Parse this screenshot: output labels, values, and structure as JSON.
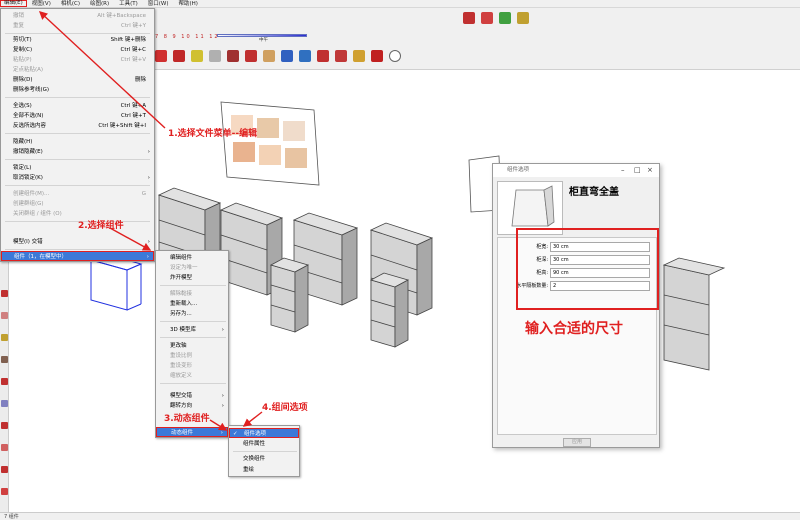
{
  "menubar": {
    "items": [
      "编辑(E)",
      "视图(V)",
      "相机(C)",
      "绘图(R)",
      "工具(T)",
      "窗口(W)",
      "帮助(H)"
    ]
  },
  "toolbar": {
    "ruler_text": "7 8 9 10 11 12",
    "scale_label": "中午"
  },
  "edit_menu": {
    "items": [
      {
        "label": "撤销",
        "shortcut": "Alt 键+Backspace",
        "disabled": true
      },
      {
        "label": "重复",
        "shortcut": "Ctrl 键+Y",
        "disabled": true
      },
      {
        "label": "剪切(T)",
        "shortcut": "Shift 键+删除"
      },
      {
        "label": "复制(C)",
        "shortcut": "Ctrl 键+C"
      },
      {
        "label": "粘贴(P)",
        "shortcut": "Ctrl 键+V",
        "disabled": true
      },
      {
        "label": "定点粘贴(A)",
        "shortcut": "",
        "disabled": true
      },
      {
        "label": "删除(D)",
        "shortcut": "删除"
      },
      {
        "label": "删除参考线(G)",
        "shortcut": ""
      },
      {
        "label": "全选(S)",
        "shortcut": "Ctrl 键+A"
      },
      {
        "label": "全部不选(N)",
        "shortcut": "Ctrl 键+T"
      },
      {
        "label": "反选所选内容",
        "shortcut": "Ctrl 键+Shift 键+I"
      },
      {
        "label": "隐藏(H)",
        "shortcut": ""
      },
      {
        "label": "撤销隐藏(E)",
        "shortcut": "",
        "submenu": true
      },
      {
        "label": "锁定(L)",
        "shortcut": ""
      },
      {
        "label": "取消锁定(K)",
        "shortcut": "",
        "submenu": true
      },
      {
        "label": "创建组件(M)...",
        "shortcut": "G",
        "disabled": true
      },
      {
        "label": "创建群组(G)",
        "shortcut": "",
        "disabled": true
      },
      {
        "label": "关闭群组 / 组件 (O)",
        "shortcut": "",
        "disabled": true
      },
      {
        "label": "模型(I) 交错",
        "shortcut": "",
        "submenu": true
      },
      {
        "label": "组件（1，在模型中）",
        "shortcut": "",
        "submenu": true,
        "highlight": true
      }
    ]
  },
  "component_submenu": {
    "items": [
      {
        "label": "编辑组件"
      },
      {
        "label": "设定为唯一",
        "disabled": true
      },
      {
        "label": "炸开模型"
      },
      {
        "label": "解除黏接",
        "disabled": true
      },
      {
        "label": "重新载入..."
      },
      {
        "label": "另存为..."
      },
      {
        "label": "3D 模型库",
        "submenu": true
      },
      {
        "label": "更改轴"
      },
      {
        "label": "重设比例",
        "disabled": true
      },
      {
        "label": "重设变形",
        "disabled": true
      },
      {
        "label": "缩放定义",
        "disabled": true
      },
      {
        "label": "模型交错",
        "submenu": true
      },
      {
        "label": "翻转方向",
        "submenu": true
      },
      {
        "label": "动态组件",
        "submenu": true,
        "highlight": true
      }
    ]
  },
  "dynamic_submenu": {
    "items": [
      {
        "label": "组件选项",
        "checked": true,
        "highlight": true
      },
      {
        "label": "组件属性"
      },
      {
        "label": "交换组件"
      },
      {
        "label": "重绘"
      }
    ]
  },
  "dialog": {
    "title": "组件选项",
    "component_name": "柜直弯全盖",
    "fields": [
      {
        "label": "柜宽:",
        "value": "30 cm"
      },
      {
        "label": "柜深:",
        "value": "30 cm"
      },
      {
        "label": "柜高:",
        "value": "90 cm"
      },
      {
        "label": "水平隔板数量:",
        "value": "2"
      }
    ],
    "apply_label": "应用"
  },
  "annotations": {
    "step1": "1.选择文件菜单--编辑",
    "step2": "2.选择组件",
    "step3": "3.动态组件",
    "step4": "4.组间选项",
    "size_hint": "输入合适的尺寸"
  },
  "status_bar": {
    "text": "7 组件"
  },
  "colors": {
    "annotation_red": "#e02020",
    "menu_highlight": "#3c79d8"
  }
}
